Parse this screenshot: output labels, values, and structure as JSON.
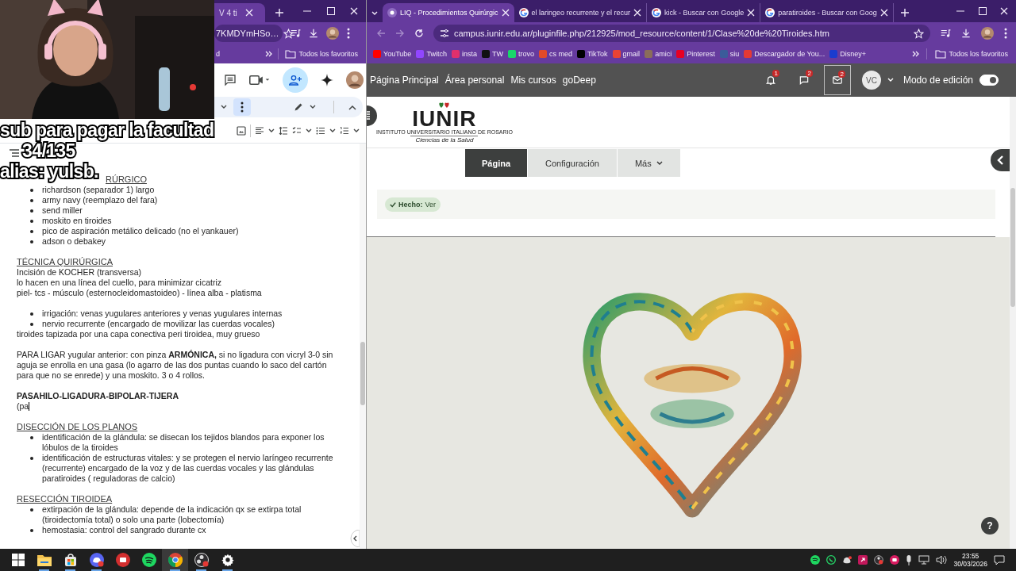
{
  "webcam": {
    "kind": "picture"
  },
  "stream_overlay": [
    "sub para pagar la facultad",
    "34/135",
    "alias: yulsb."
  ],
  "docs_window": {
    "tab_title": "V 4 ti",
    "address": "7KMDYmHSo…",
    "bookmarks": [
      "d"
    ],
    "all_bookmarks": "Todos los favoritos",
    "document": {
      "groups": [
        [
          {
            "kind": "covered_heading",
            "text": "RÚRGICO"
          },
          {
            "kind": "bullet",
            "text": "richardson (separador 1) largo"
          },
          {
            "kind": "bullet",
            "text": "army navy (reemplazo del fara)"
          },
          {
            "kind": "bullet",
            "text": "send miller"
          },
          {
            "kind": "bullet",
            "text": "moskito en tiroides"
          },
          {
            "kind": "bullet",
            "text": "pico de aspiración metálico delicado (no el yankauer)"
          },
          {
            "kind": "bullet",
            "text": "adson o debakey"
          }
        ],
        [
          {
            "kind": "heading",
            "text": "TÉCNICA QUIRÚRGICA"
          },
          {
            "kind": "line",
            "text": "Incisión de KOCHER (transversa)"
          },
          {
            "kind": "line",
            "text": "lo hacen en una línea del cuello, para minimizar cicatriz"
          },
          {
            "kind": "line",
            "text": "piel- tcs - músculo (esternocleidomastoideo) - línea alba - platisma"
          }
        ],
        [
          {
            "kind": "bullet",
            "text": "irrigación: venas yugulares anteriores y venas yugulares internas"
          },
          {
            "kind": "bullet",
            "text": "nervio recurrente (encargado de movilizar las cuerdas vocales)"
          },
          {
            "kind": "line",
            "text": "tiroides tapizada por una capa conectiva peri tiroidea, muy grueso"
          }
        ],
        [
          {
            "kind": "line",
            "text": "PARA LIGAR yugular anterior: con pinza **ARMÓNICA,** si no ligadura con vicryl 3-0 sin aguja se enrolla en una gasa (lo agarro de las dos puntas cuando lo saco del cartón para que no se enrede) y una moskito. 3 o 4 rollos."
          }
        ],
        [
          {
            "kind": "bold",
            "text": "PASAHILO-LIGADURA-BIPOLAR-TIJERA"
          },
          {
            "kind": "cursor_line",
            "text": "(pa"
          }
        ],
        [
          {
            "kind": "heading",
            "text": "DISECCIÓN DE LOS PLANOS"
          },
          {
            "kind": "bullet",
            "text": "identificación de la glándula: se disecan los tejidos blandos para exponer los lóbulos de la tiroides"
          },
          {
            "kind": "bullet",
            "text": "identificación de estructuras vitales: y se protegen el nervio laríngeo recurrente (recurrente) encargado de la voz y de las cuerdas vocales y las glándulas paratiroides ( reguladoras de calcio)"
          }
        ],
        [
          {
            "kind": "heading",
            "text": "RESECCIÓN TIROIDEA"
          },
          {
            "kind": "bullet",
            "text": "extirpación de la glándula: depende de la indicación qx se extirpa total (tiroidectomía total) o solo una parte (lobectomía)"
          },
          {
            "kind": "bullet",
            "text": "hemostasia: control del sangrado durante cx"
          }
        ]
      ]
    }
  },
  "browser": {
    "tabs": [
      {
        "title": "LIQ - Procedimientos Quirúrgic",
        "kind": "site",
        "selected": true
      },
      {
        "title": "el laringeo recurrente y el recur",
        "kind": "google",
        "selected": false
      },
      {
        "title": "kick - Buscar con Google",
        "kind": "google",
        "selected": false
      },
      {
        "title": "paratiroides - Buscar con Goog",
        "kind": "google",
        "selected": false
      }
    ],
    "address": "campus.iunir.edu.ar/pluginfile.php/212925/mod_resource/content/1/Clase%20de%20Tiroides.htm",
    "bookmarks": [
      {
        "label": "YouTube",
        "color": "#ff0000"
      },
      {
        "label": "Twitch",
        "color": "#9146ff"
      },
      {
        "label": "insta",
        "color": "#e1306c"
      },
      {
        "label": "TW",
        "color": "#111111"
      },
      {
        "label": "trovo",
        "color": "#19d66b"
      },
      {
        "label": "cs med",
        "color": "#e24a2a"
      },
      {
        "label": "TikTok",
        "color": "#000000"
      },
      {
        "label": "gmail",
        "color": "#ea4335"
      },
      {
        "label": "amici",
        "color": "#8a6d5a"
      },
      {
        "label": "Pinterest",
        "color": "#e60023"
      },
      {
        "label": "siu",
        "color": "#3b5b9a"
      },
      {
        "label": "Descargador de You...",
        "color": "#e53935"
      },
      {
        "label": "Disney+",
        "color": "#1a3ccf"
      }
    ],
    "all_bookmarks": "Todos los favoritos"
  },
  "site": {
    "nav": [
      "Página Principal",
      "Área personal",
      "Mis cursos",
      "goDeep"
    ],
    "alerts": [
      {
        "kind": "bell",
        "count": "1",
        "selected": false
      },
      {
        "kind": "chat",
        "count": "2",
        "selected": false
      },
      {
        "kind": "mail",
        "count": "2",
        "selected": true
      }
    ],
    "user_initials": "VC",
    "edit_mode": {
      "label": "Modo de edición",
      "on": true
    },
    "logo": {
      "name": "IUNIR",
      "subtitle": "INSTITUTO UNIVERSITARIO ITALIANO DE ROSARIO",
      "tagline": "Ciencias de la Salud"
    },
    "page_tabs": [
      {
        "label": "Página",
        "selected": true
      },
      {
        "label": "Configuración",
        "selected": false
      },
      {
        "label": "Más",
        "selected": false
      }
    ],
    "completion": {
      "label": "Hecho:",
      "value": "Ver"
    },
    "content": {
      "kind": "picture"
    },
    "help": "?"
  },
  "taskbar": {
    "apps": [
      {
        "kind": "start",
        "open": false,
        "selected": false
      },
      {
        "kind": "files",
        "open": true,
        "selected": false
      },
      {
        "kind": "store",
        "open": true,
        "selected": false
      },
      {
        "kind": "chat",
        "open": true,
        "selected": false
      },
      {
        "kind": "red",
        "open": false,
        "selected": false
      },
      {
        "kind": "music",
        "open": false,
        "selected": false
      },
      {
        "kind": "browser",
        "open": true,
        "selected": true
      },
      {
        "kind": "recorder",
        "open": true,
        "selected": false
      },
      {
        "kind": "settings",
        "open": true,
        "selected": false
      }
    ],
    "time": "23:55",
    "date": "30/03/2026"
  }
}
